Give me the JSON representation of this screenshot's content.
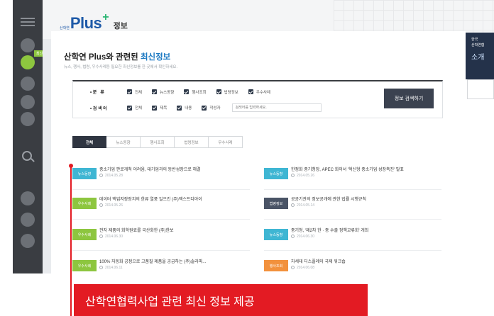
{
  "logo": {
    "small": "산학연",
    "plus": "Plus",
    "info": "정보"
  },
  "sidebar": {
    "active_tag": "최신정보"
  },
  "right_panel": {
    "line1": "한국",
    "line2": "산학연협",
    "big": "소개"
  },
  "page": {
    "title_prefix": "산학연 Plus와 관련된 ",
    "title_highlight": "최신정보",
    "subtitle": "뉴스, 행사, 법령, 우수사례등 필요한 최신정보를 한 곳에서 확인하세요."
  },
  "filter": {
    "type_label": "• 분   류",
    "type_options": [
      "전체",
      "뉴스동향",
      "행사조회",
      "법령정보",
      "우수사례"
    ],
    "search_label": "• 검 색 어",
    "search_options": [
      "전체",
      "제목",
      "내용",
      "작성자"
    ],
    "search_placeholder": "검색어를 입력하세요.",
    "search_button": "정보 검색하기"
  },
  "tabs": [
    "전체",
    "뉴스동향",
    "행사조회",
    "법령정보",
    "우수사례"
  ],
  "news_left": [
    {
      "badge": "뉴스동향",
      "title": "중소기업 판로개척 어려움, 대기업과의 동반성장으로 해결",
      "date": "2014.05.28"
    },
    {
      "badge": "우수사례",
      "title": "데이터 백업저장장치의 한류 열풍 일으킨 (주)엑스트디아이",
      "date": "2014.05.26"
    },
    {
      "badge": "우수사례",
      "title": "전자 제품의 회학원료를 국산화한 (주)한보",
      "date": "2014.06.30"
    },
    {
      "badge": "우수사례",
      "title": "100% 자동화 공정으로 고품질 제품을 공급하는 (주)솔라파...",
      "date": "2014.06.11"
    }
  ],
  "news_right": [
    {
      "badge": "뉴스동향",
      "title": "한정화 중기청장, APEC 회의서 '혁신형 중소기업 성장촉진' 발표",
      "date": "2014.05.26"
    },
    {
      "badge": "법령정보",
      "title": "공공기관의 정보공개에 관한 법률 시행규칙",
      "date": "2014.05.14"
    },
    {
      "badge": "뉴스동향",
      "title": "중기청, '제2차 한 · 중 수출 정책교류회' 개최",
      "date": "2014.06.30"
    },
    {
      "badge": "행사조회",
      "title": "차세대 디스플레이 국제 워크숍",
      "date": "2014.06.08"
    }
  ],
  "badge_colors": {
    "뉴스동향": "#3fb6d3",
    "우수사례": "#8dc63f",
    "법령정보": "#4a5466",
    "행사조회": "#f2913d"
  },
  "caption": "산학연협력사업 관련 최신 정보 제공"
}
